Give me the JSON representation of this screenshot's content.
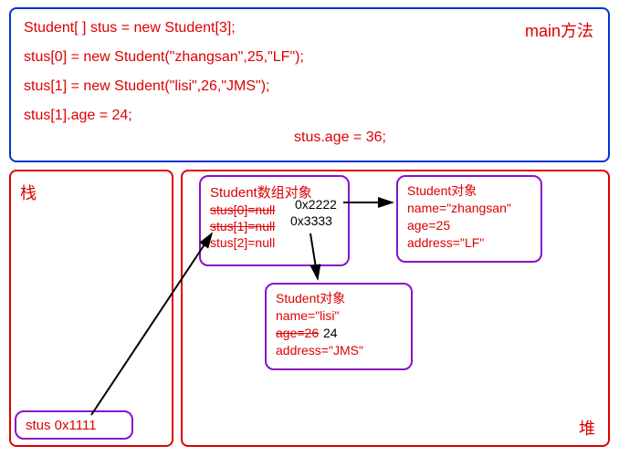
{
  "code": {
    "main_label": "main方法",
    "line1": "Student[ ]  stus  = new Student[3];",
    "line2": "stus[0] = new Student(\"zhangsan\",25,\"LF\");",
    "line3": "stus[1] = new Student(\"lisi\",26,\"JMS\");",
    "line4": "stus[1].age = 24;",
    "inline": "stus.age = 36;"
  },
  "stack": {
    "title": "栈",
    "var_label": "stus  0x1111"
  },
  "heap": {
    "title": "堆",
    "array": {
      "title": "Student数组对象",
      "row0_struck": "stus[0]=null",
      "row1_struck": "stus[1]=null",
      "row2": "stus[2]=null",
      "addr0": "0x2222",
      "addr1": "0x3333"
    },
    "obj1": {
      "title": "Student对象",
      "name": "name=\"zhangsan\"",
      "age": "age=25",
      "address": "address=\"LF\""
    },
    "obj2": {
      "title": "Student对象",
      "name": "name=\"lisi\"",
      "age_struck": "age=26",
      "age_new": "24",
      "address": "address=\"JMS\""
    }
  },
  "colors": {
    "red": "#d00",
    "blue": "#0033cc",
    "purple": "#8811cc",
    "black": "#000"
  }
}
